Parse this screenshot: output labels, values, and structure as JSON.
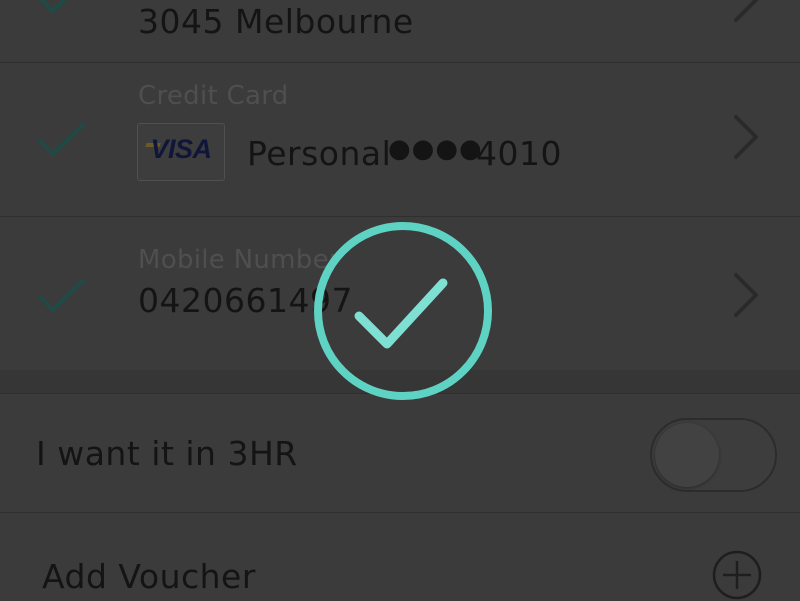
{
  "address": {
    "value": "3045 Melbourne"
  },
  "credit_card": {
    "label": "Credit Card",
    "brand": "VISA",
    "name": "Personal",
    "mask": "●●●●",
    "last4": "4010"
  },
  "mobile": {
    "label": "Mobile Number",
    "value": "0420661497"
  },
  "three_hr": {
    "label": "I want it in 3HR",
    "enabled": false
  },
  "voucher": {
    "label": "Add Voucher"
  },
  "status": {
    "state": "success",
    "icon": "check-circle-icon"
  },
  "colors": {
    "accent": "#5fd3c3",
    "check": "#1f4a46",
    "dim_background": "#3b3b3b"
  }
}
